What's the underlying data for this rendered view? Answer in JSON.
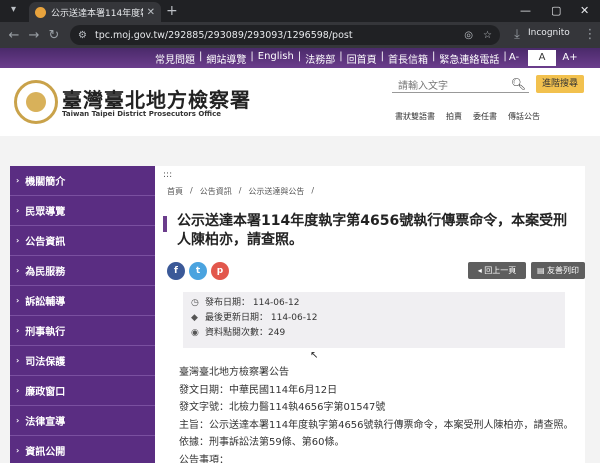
{
  "browser": {
    "tab_title": "公示送達本署114年度執字第465",
    "tab_close": "✕",
    "new_tab": "+",
    "url": "tpc.moj.gov.tw/292885/293089/293093/1296598/post",
    "incognito": "Incognito"
  },
  "topbar": {
    "links": [
      "常見問題",
      "|",
      "網站導覽",
      "|",
      "English",
      "|",
      "法務部",
      "|",
      "回首頁",
      "|",
      "首長信箱",
      "|",
      "緊急連絡電話",
      "|"
    ],
    "font_small": "A-",
    "font_mid": "A",
    "font_large": "A+"
  },
  "header": {
    "site_name": "臺灣臺北地方檢察署",
    "site_name_en": "Taiwan Taipei District Prosecutors Office",
    "search_placeholder": "請輸入文字",
    "advanced_search": "進階搜尋",
    "quick_links": [
      "書狀雙語書",
      "拍賣",
      "委任書",
      "傳話公告"
    ]
  },
  "sidebar": {
    "items": [
      {
        "label": "機關簡介"
      },
      {
        "label": "民眾導覽"
      },
      {
        "label": "公告資訊"
      },
      {
        "label": "為民服務"
      },
      {
        "label": "訴訟輔導"
      },
      {
        "label": "刑事執行"
      },
      {
        "label": "司法保護"
      },
      {
        "label": "廉政窗口"
      },
      {
        "label": "法律宣導"
      },
      {
        "label": "資訊公開"
      }
    ]
  },
  "breadcrumb": [
    "首頁",
    "/",
    "公告資訊",
    "/",
    "公示送達與公告",
    "/"
  ],
  "article": {
    "title": "公示送達本署114年度執字第4656號執行傳票命令，本案受刑人陳柏亦，請查照。",
    "back_button": "回上一頁",
    "print_button": "友善列印",
    "meta": {
      "publish": "發布日期： 114-06-12",
      "updated": "最後更新日期： 114-06-12",
      "views": "資料點閱次數：249"
    },
    "body": [
      "臺灣臺北地方檢察署公告",
      "發文日期：中華民國114年6月12日",
      "發文字號：北檢力醫114執4656字第01547號",
      "主旨：公示送達本署114年度執字第4656號執行傳票命令，本案受刑人陳柏亦，請查照。",
      "依據：刑事訴訟法第59條、第60條。",
      "公告事項："
    ]
  },
  "colors": {
    "purple": "#5a2d82",
    "gold": "#f2c14e"
  }
}
